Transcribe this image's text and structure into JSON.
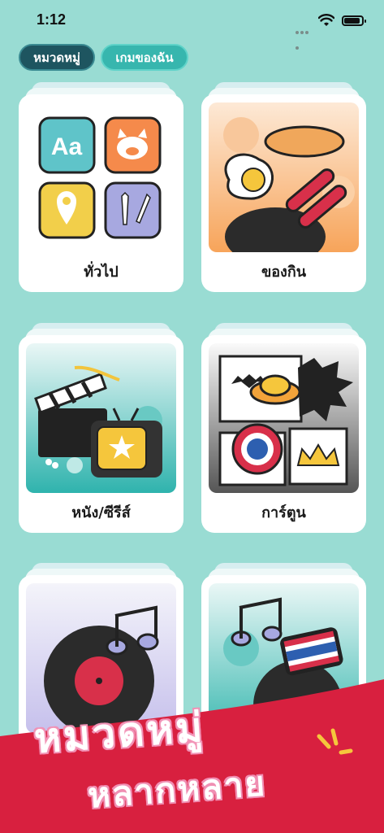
{
  "status": {
    "time": "1:12"
  },
  "tabs": [
    {
      "label": "หมวดหมู่",
      "active": true
    },
    {
      "label": "เกมของฉัน",
      "active": false
    }
  ],
  "categories": [
    {
      "label": "ทั่วไป",
      "art": "general-icons"
    },
    {
      "label": "ของกิน",
      "art": "food"
    },
    {
      "label": "หนัง/ซีรีส์",
      "art": "movies-tv"
    },
    {
      "label": "การ์ตูน",
      "art": "cartoon"
    },
    {
      "label": "",
      "art": "music"
    },
    {
      "label": "",
      "art": "thai-music"
    }
  ],
  "general_icons": {
    "text_icon": "Aa"
  },
  "banner": {
    "title": "หมวดหมู่",
    "subtitle": "หลากหลาย"
  },
  "colors": {
    "background": "#99dcd3",
    "banner_red": "#d8203f",
    "active_tab": "#1e5560",
    "inactive_tab": "#37b6ae"
  }
}
